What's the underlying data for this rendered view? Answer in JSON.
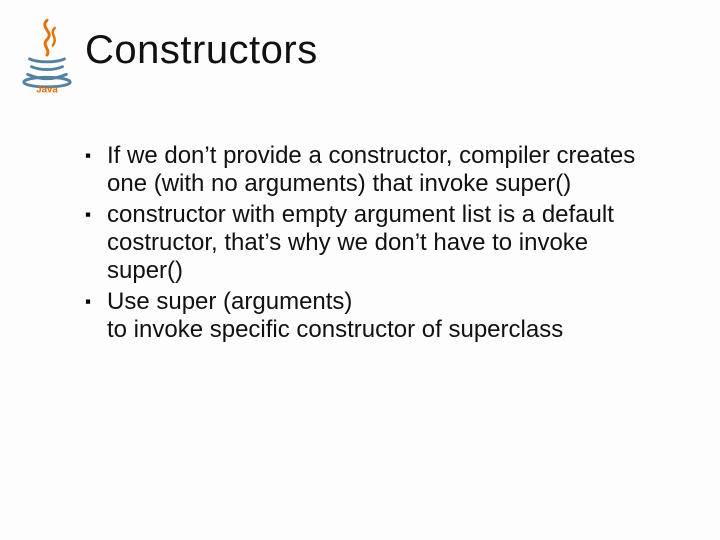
{
  "title": "Constructors",
  "logo": {
    "name": "java-logo"
  },
  "bullets": [
    {
      "text": "If we don’t provide a constructor, compiler creates one (with no arguments) that invoke super()"
    },
    {
      "text": "constructor with empty argument list is a default costructor, that’s why we don’t have to invoke super()"
    },
    {
      "text": "Use super (arguments)\nto invoke specific constructor of superclass"
    }
  ]
}
